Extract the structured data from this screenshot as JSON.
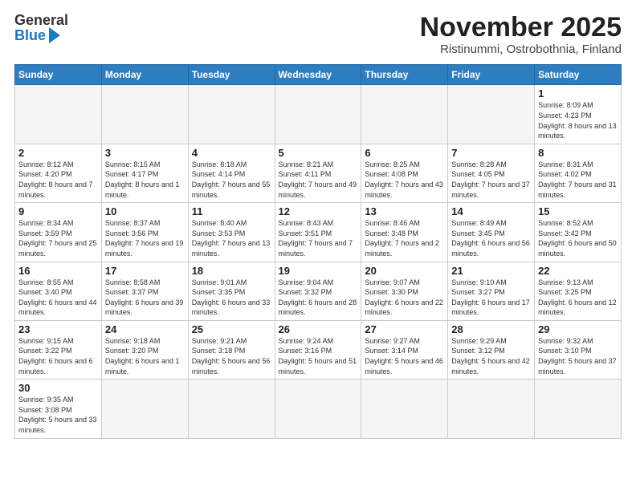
{
  "logo": {
    "text_general": "General",
    "text_blue": "Blue"
  },
  "header": {
    "month_title": "November 2025",
    "location": "Ristinummi, Ostrobothnia, Finland"
  },
  "weekdays": [
    "Sunday",
    "Monday",
    "Tuesday",
    "Wednesday",
    "Thursday",
    "Friday",
    "Saturday"
  ],
  "weeks": [
    [
      {
        "day": "",
        "info": ""
      },
      {
        "day": "",
        "info": ""
      },
      {
        "day": "",
        "info": ""
      },
      {
        "day": "",
        "info": ""
      },
      {
        "day": "",
        "info": ""
      },
      {
        "day": "",
        "info": ""
      },
      {
        "day": "1",
        "info": "Sunrise: 8:09 AM\nSunset: 4:23 PM\nDaylight: 8 hours\nand 13 minutes."
      }
    ],
    [
      {
        "day": "2",
        "info": "Sunrise: 8:12 AM\nSunset: 4:20 PM\nDaylight: 8 hours\nand 7 minutes."
      },
      {
        "day": "3",
        "info": "Sunrise: 8:15 AM\nSunset: 4:17 PM\nDaylight: 8 hours\nand 1 minute."
      },
      {
        "day": "4",
        "info": "Sunrise: 8:18 AM\nSunset: 4:14 PM\nDaylight: 7 hours\nand 55 minutes."
      },
      {
        "day": "5",
        "info": "Sunrise: 8:21 AM\nSunset: 4:11 PM\nDaylight: 7 hours\nand 49 minutes."
      },
      {
        "day": "6",
        "info": "Sunrise: 8:25 AM\nSunset: 4:08 PM\nDaylight: 7 hours\nand 43 minutes."
      },
      {
        "day": "7",
        "info": "Sunrise: 8:28 AM\nSunset: 4:05 PM\nDaylight: 7 hours\nand 37 minutes."
      },
      {
        "day": "8",
        "info": "Sunrise: 8:31 AM\nSunset: 4:02 PM\nDaylight: 7 hours\nand 31 minutes."
      }
    ],
    [
      {
        "day": "9",
        "info": "Sunrise: 8:34 AM\nSunset: 3:59 PM\nDaylight: 7 hours\nand 25 minutes."
      },
      {
        "day": "10",
        "info": "Sunrise: 8:37 AM\nSunset: 3:56 PM\nDaylight: 7 hours\nand 19 minutes."
      },
      {
        "day": "11",
        "info": "Sunrise: 8:40 AM\nSunset: 3:53 PM\nDaylight: 7 hours\nand 13 minutes."
      },
      {
        "day": "12",
        "info": "Sunrise: 8:43 AM\nSunset: 3:51 PM\nDaylight: 7 hours\nand 7 minutes."
      },
      {
        "day": "13",
        "info": "Sunrise: 8:46 AM\nSunset: 3:48 PM\nDaylight: 7 hours\nand 2 minutes."
      },
      {
        "day": "14",
        "info": "Sunrise: 8:49 AM\nSunset: 3:45 PM\nDaylight: 6 hours\nand 56 minutes."
      },
      {
        "day": "15",
        "info": "Sunrise: 8:52 AM\nSunset: 3:42 PM\nDaylight: 6 hours\nand 50 minutes."
      }
    ],
    [
      {
        "day": "16",
        "info": "Sunrise: 8:55 AM\nSunset: 3:40 PM\nDaylight: 6 hours\nand 44 minutes."
      },
      {
        "day": "17",
        "info": "Sunrise: 8:58 AM\nSunset: 3:37 PM\nDaylight: 6 hours\nand 39 minutes."
      },
      {
        "day": "18",
        "info": "Sunrise: 9:01 AM\nSunset: 3:35 PM\nDaylight: 6 hours\nand 33 minutes."
      },
      {
        "day": "19",
        "info": "Sunrise: 9:04 AM\nSunset: 3:32 PM\nDaylight: 6 hours\nand 28 minutes."
      },
      {
        "day": "20",
        "info": "Sunrise: 9:07 AM\nSunset: 3:30 PM\nDaylight: 6 hours\nand 22 minutes."
      },
      {
        "day": "21",
        "info": "Sunrise: 9:10 AM\nSunset: 3:27 PM\nDaylight: 6 hours\nand 17 minutes."
      },
      {
        "day": "22",
        "info": "Sunrise: 9:13 AM\nSunset: 3:25 PM\nDaylight: 6 hours\nand 12 minutes."
      }
    ],
    [
      {
        "day": "23",
        "info": "Sunrise: 9:15 AM\nSunset: 3:22 PM\nDaylight: 6 hours\nand 6 minutes."
      },
      {
        "day": "24",
        "info": "Sunrise: 9:18 AM\nSunset: 3:20 PM\nDaylight: 6 hours\nand 1 minute."
      },
      {
        "day": "25",
        "info": "Sunrise: 9:21 AM\nSunset: 3:18 PM\nDaylight: 5 hours\nand 56 minutes."
      },
      {
        "day": "26",
        "info": "Sunrise: 9:24 AM\nSunset: 3:16 PM\nDaylight: 5 hours\nand 51 minutes."
      },
      {
        "day": "27",
        "info": "Sunrise: 9:27 AM\nSunset: 3:14 PM\nDaylight: 5 hours\nand 46 minutes."
      },
      {
        "day": "28",
        "info": "Sunrise: 9:29 AM\nSunset: 3:12 PM\nDaylight: 5 hours\nand 42 minutes."
      },
      {
        "day": "29",
        "info": "Sunrise: 9:32 AM\nSunset: 3:10 PM\nDaylight: 5 hours\nand 37 minutes."
      }
    ],
    [
      {
        "day": "30",
        "info": "Sunrise: 9:35 AM\nSunset: 3:08 PM\nDaylight: 5 hours\nand 33 minutes."
      },
      {
        "day": "",
        "info": ""
      },
      {
        "day": "",
        "info": ""
      },
      {
        "day": "",
        "info": ""
      },
      {
        "day": "",
        "info": ""
      },
      {
        "day": "",
        "info": ""
      },
      {
        "day": "",
        "info": ""
      }
    ]
  ]
}
